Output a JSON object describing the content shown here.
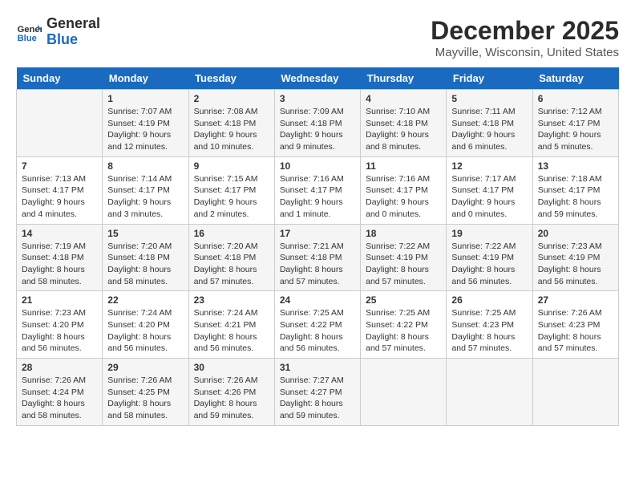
{
  "header": {
    "logo_line1": "General",
    "logo_line2": "Blue",
    "title": "December 2025",
    "subtitle": "Mayville, Wisconsin, United States"
  },
  "days_of_week": [
    "Sunday",
    "Monday",
    "Tuesday",
    "Wednesday",
    "Thursday",
    "Friday",
    "Saturday"
  ],
  "weeks": [
    [
      {
        "day": "",
        "sunrise": "",
        "sunset": "",
        "daylight": ""
      },
      {
        "day": "1",
        "sunrise": "Sunrise: 7:07 AM",
        "sunset": "Sunset: 4:19 PM",
        "daylight": "Daylight: 9 hours and 12 minutes."
      },
      {
        "day": "2",
        "sunrise": "Sunrise: 7:08 AM",
        "sunset": "Sunset: 4:18 PM",
        "daylight": "Daylight: 9 hours and 10 minutes."
      },
      {
        "day": "3",
        "sunrise": "Sunrise: 7:09 AM",
        "sunset": "Sunset: 4:18 PM",
        "daylight": "Daylight: 9 hours and 9 minutes."
      },
      {
        "day": "4",
        "sunrise": "Sunrise: 7:10 AM",
        "sunset": "Sunset: 4:18 PM",
        "daylight": "Daylight: 9 hours and 8 minutes."
      },
      {
        "day": "5",
        "sunrise": "Sunrise: 7:11 AM",
        "sunset": "Sunset: 4:18 PM",
        "daylight": "Daylight: 9 hours and 6 minutes."
      },
      {
        "day": "6",
        "sunrise": "Sunrise: 7:12 AM",
        "sunset": "Sunset: 4:17 PM",
        "daylight": "Daylight: 9 hours and 5 minutes."
      }
    ],
    [
      {
        "day": "7",
        "sunrise": "Sunrise: 7:13 AM",
        "sunset": "Sunset: 4:17 PM",
        "daylight": "Daylight: 9 hours and 4 minutes."
      },
      {
        "day": "8",
        "sunrise": "Sunrise: 7:14 AM",
        "sunset": "Sunset: 4:17 PM",
        "daylight": "Daylight: 9 hours and 3 minutes."
      },
      {
        "day": "9",
        "sunrise": "Sunrise: 7:15 AM",
        "sunset": "Sunset: 4:17 PM",
        "daylight": "Daylight: 9 hours and 2 minutes."
      },
      {
        "day": "10",
        "sunrise": "Sunrise: 7:16 AM",
        "sunset": "Sunset: 4:17 PM",
        "daylight": "Daylight: 9 hours and 1 minute."
      },
      {
        "day": "11",
        "sunrise": "Sunrise: 7:16 AM",
        "sunset": "Sunset: 4:17 PM",
        "daylight": "Daylight: 9 hours and 0 minutes."
      },
      {
        "day": "12",
        "sunrise": "Sunrise: 7:17 AM",
        "sunset": "Sunset: 4:17 PM",
        "daylight": "Daylight: 9 hours and 0 minutes."
      },
      {
        "day": "13",
        "sunrise": "Sunrise: 7:18 AM",
        "sunset": "Sunset: 4:17 PM",
        "daylight": "Daylight: 8 hours and 59 minutes."
      }
    ],
    [
      {
        "day": "14",
        "sunrise": "Sunrise: 7:19 AM",
        "sunset": "Sunset: 4:18 PM",
        "daylight": "Daylight: 8 hours and 58 minutes."
      },
      {
        "day": "15",
        "sunrise": "Sunrise: 7:20 AM",
        "sunset": "Sunset: 4:18 PM",
        "daylight": "Daylight: 8 hours and 58 minutes."
      },
      {
        "day": "16",
        "sunrise": "Sunrise: 7:20 AM",
        "sunset": "Sunset: 4:18 PM",
        "daylight": "Daylight: 8 hours and 57 minutes."
      },
      {
        "day": "17",
        "sunrise": "Sunrise: 7:21 AM",
        "sunset": "Sunset: 4:18 PM",
        "daylight": "Daylight: 8 hours and 57 minutes."
      },
      {
        "day": "18",
        "sunrise": "Sunrise: 7:22 AM",
        "sunset": "Sunset: 4:19 PM",
        "daylight": "Daylight: 8 hours and 57 minutes."
      },
      {
        "day": "19",
        "sunrise": "Sunrise: 7:22 AM",
        "sunset": "Sunset: 4:19 PM",
        "daylight": "Daylight: 8 hours and 56 minutes."
      },
      {
        "day": "20",
        "sunrise": "Sunrise: 7:23 AM",
        "sunset": "Sunset: 4:19 PM",
        "daylight": "Daylight: 8 hours and 56 minutes."
      }
    ],
    [
      {
        "day": "21",
        "sunrise": "Sunrise: 7:23 AM",
        "sunset": "Sunset: 4:20 PM",
        "daylight": "Daylight: 8 hours and 56 minutes."
      },
      {
        "day": "22",
        "sunrise": "Sunrise: 7:24 AM",
        "sunset": "Sunset: 4:20 PM",
        "daylight": "Daylight: 8 hours and 56 minutes."
      },
      {
        "day": "23",
        "sunrise": "Sunrise: 7:24 AM",
        "sunset": "Sunset: 4:21 PM",
        "daylight": "Daylight: 8 hours and 56 minutes."
      },
      {
        "day": "24",
        "sunrise": "Sunrise: 7:25 AM",
        "sunset": "Sunset: 4:22 PM",
        "daylight": "Daylight: 8 hours and 56 minutes."
      },
      {
        "day": "25",
        "sunrise": "Sunrise: 7:25 AM",
        "sunset": "Sunset: 4:22 PM",
        "daylight": "Daylight: 8 hours and 57 minutes."
      },
      {
        "day": "26",
        "sunrise": "Sunrise: 7:25 AM",
        "sunset": "Sunset: 4:23 PM",
        "daylight": "Daylight: 8 hours and 57 minutes."
      },
      {
        "day": "27",
        "sunrise": "Sunrise: 7:26 AM",
        "sunset": "Sunset: 4:23 PM",
        "daylight": "Daylight: 8 hours and 57 minutes."
      }
    ],
    [
      {
        "day": "28",
        "sunrise": "Sunrise: 7:26 AM",
        "sunset": "Sunset: 4:24 PM",
        "daylight": "Daylight: 8 hours and 58 minutes."
      },
      {
        "day": "29",
        "sunrise": "Sunrise: 7:26 AM",
        "sunset": "Sunset: 4:25 PM",
        "daylight": "Daylight: 8 hours and 58 minutes."
      },
      {
        "day": "30",
        "sunrise": "Sunrise: 7:26 AM",
        "sunset": "Sunset: 4:26 PM",
        "daylight": "Daylight: 8 hours and 59 minutes."
      },
      {
        "day": "31",
        "sunrise": "Sunrise: 7:27 AM",
        "sunset": "Sunset: 4:27 PM",
        "daylight": "Daylight: 8 hours and 59 minutes."
      },
      {
        "day": "",
        "sunrise": "",
        "sunset": "",
        "daylight": ""
      },
      {
        "day": "",
        "sunrise": "",
        "sunset": "",
        "daylight": ""
      },
      {
        "day": "",
        "sunrise": "",
        "sunset": "",
        "daylight": ""
      }
    ]
  ]
}
